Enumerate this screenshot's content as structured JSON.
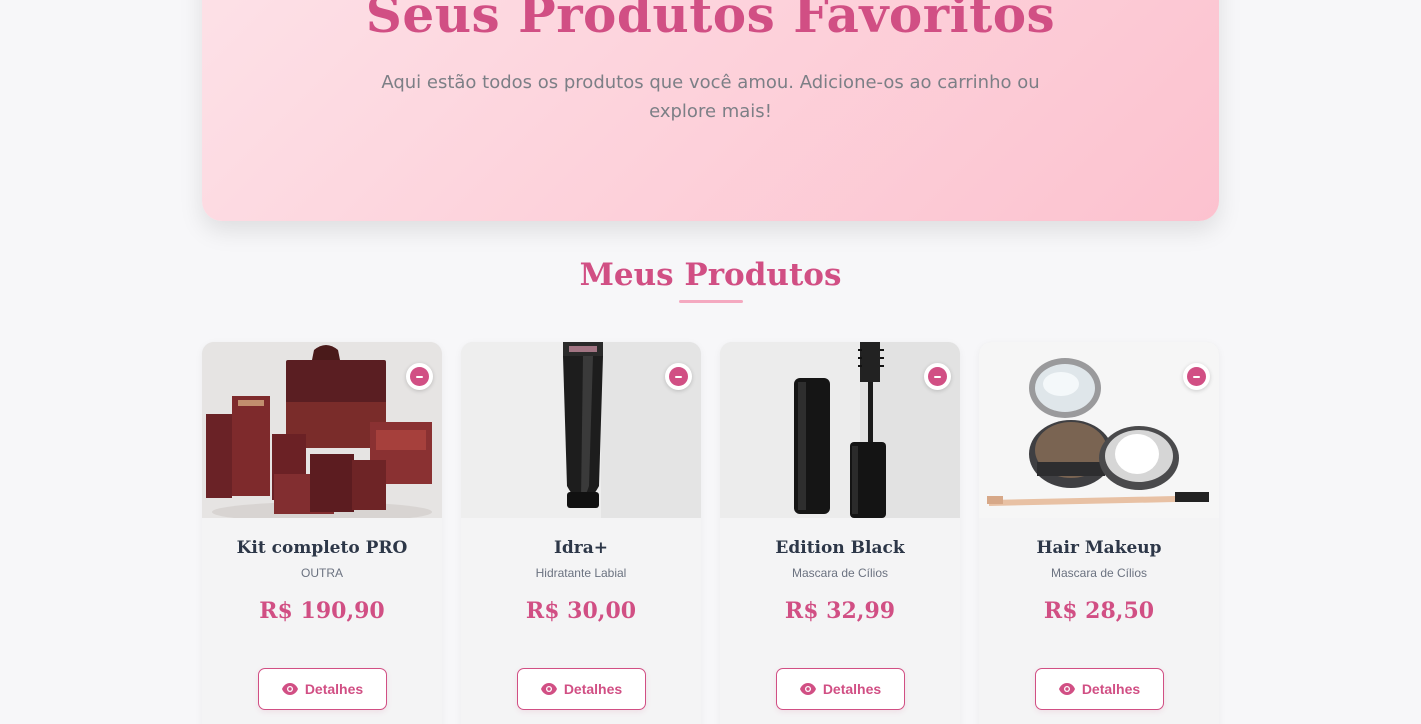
{
  "hero": {
    "title": "Seus Produtos Favoritos",
    "subtitle": "Aqui estão todos os produtos que você amou. Adicione-os ao carrinho ou explore mais!"
  },
  "section": {
    "title": "Meus Produtos"
  },
  "colors": {
    "accent": "#d14f84",
    "hero_gradient_start": "#fde2e8",
    "hero_gradient_end": "#fcc2cf",
    "text_dark": "#2d3748",
    "text_muted": "#6b7280"
  },
  "products": [
    {
      "name": "Kit completo PRO",
      "category": "OUTRA",
      "price": "R$ 190,90",
      "details_label": "Detalhes",
      "image": "makeup-kit-boxes",
      "remove_icon": "minus-circle-icon"
    },
    {
      "name": "Idra+",
      "category": "Hidratante Labial",
      "price": "R$ 30,00",
      "details_label": "Detalhes",
      "image": "lip-balm-tube",
      "remove_icon": "minus-circle-icon"
    },
    {
      "name": "Edition Black",
      "category": "Mascara de Cílios",
      "price": "R$ 32,99",
      "details_label": "Detalhes",
      "image": "mascara-wand",
      "remove_icon": "minus-circle-icon"
    },
    {
      "name": "Hair Makeup",
      "category": "Mascara de Cílios",
      "price": "R$ 28,50",
      "details_label": "Detalhes",
      "image": "compact-powder-brush",
      "remove_icon": "minus-circle-icon"
    }
  ]
}
